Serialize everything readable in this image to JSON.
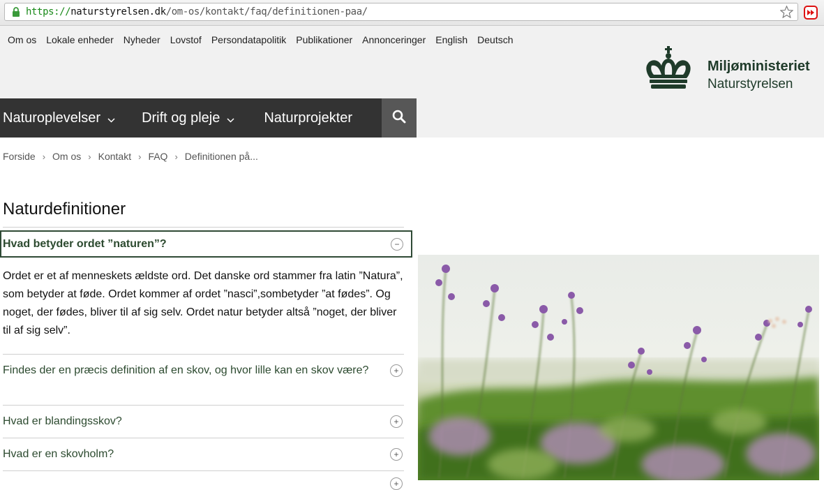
{
  "browser": {
    "url_scheme": "https://",
    "url_host": "naturstyrelsen.dk",
    "url_path": "/om-os/kontakt/faq/definitionen-paa/"
  },
  "topnav": [
    "Om os",
    "Lokale enheder",
    "Nyheder",
    "Lovstof",
    "Persondatapolitik",
    "Publikationer",
    "Annonceringer",
    "English",
    "Deutsch"
  ],
  "logo": {
    "line1": "Miljøministeriet",
    "line2": "Naturstyrelsen"
  },
  "mainnav": [
    {
      "label": "Naturoplevelser"
    },
    {
      "label": "Drift og pleje"
    },
    {
      "label": "Naturprojekter"
    }
  ],
  "breadcrumb": [
    "Forside",
    "Om os",
    "Kontakt",
    "FAQ",
    "Definitionen på..."
  ],
  "page_title": "Naturdefinitioner",
  "faq": {
    "open_question": "Hvad betyder ordet ”naturen”?",
    "open_answer": "Ordet er et af menneskets ældste ord. Det danske ord stammer fra latin ”Natura”, som betyder at føde. Ordet kommer af ordet ”nasci”,sombetyder ”at fødes”. Og noget, der fødes, bliver til af sig selv. Ordet natur betyder altså ”noget, der bliver til af sig selv”.",
    "items": [
      "Findes der en præcis definition af en skov, og hvor lille kan en skov være?",
      "Hvad er blandingsskov?",
      "Hvad er en skovholm?"
    ],
    "open_toggle": "−",
    "closed_toggle": "+"
  },
  "colors": {
    "nav_bg": "#333333",
    "search_bg": "#575757",
    "accent_green": "#2c4a2f",
    "band_bg": "#f1f1f1"
  }
}
